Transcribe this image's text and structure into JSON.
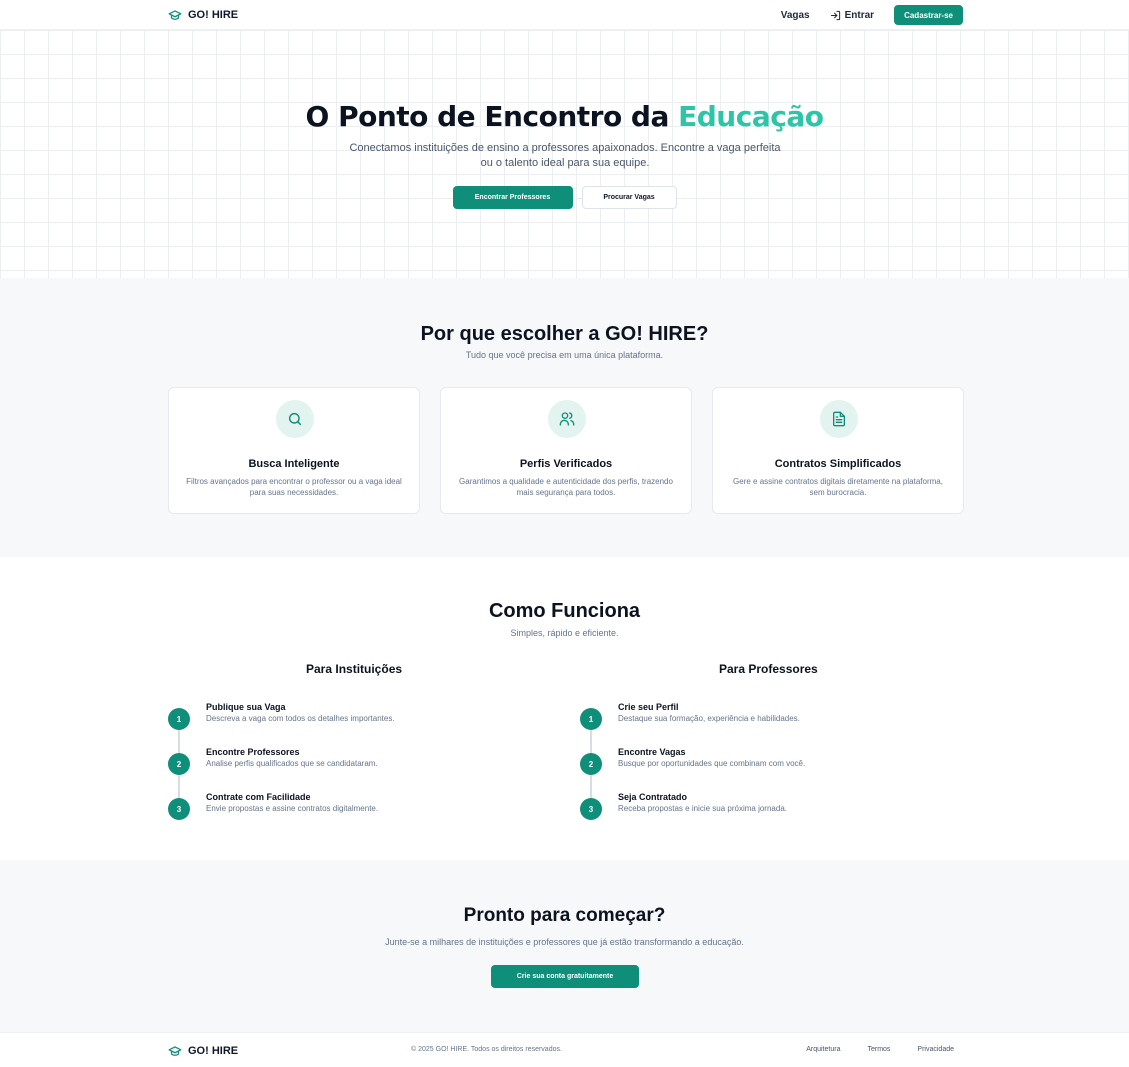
{
  "brand": {
    "name": "GO! HIRE",
    "icon": "graduation-cap-icon",
    "accent_color": "#0f8f7a",
    "highlight_color": "#2ec4a6"
  },
  "header": {
    "nav": {
      "jobs": "Vagas",
      "login": "Entrar",
      "signup": "Cadastrar-se"
    }
  },
  "hero": {
    "title_prefix": "O Ponto de Encontro da ",
    "title_highlight": "Educação",
    "subtitle": "Conectamos instituições de ensino a professores apaixonados. Encontre a vaga perfeita ou o talento ideal para sua equipe.",
    "primary_cta": "Encontrar Professores",
    "secondary_cta": "Procurar Vagas"
  },
  "why": {
    "title": "Por que escolher a GO! HIRE?",
    "subtitle": "Tudo que você precisa em uma única plataforma.",
    "cards": [
      {
        "icon": "search-icon",
        "title": "Busca Inteligente",
        "description": "Filtros avançados para encontrar o professor ou a vaga ideal para suas necessidades."
      },
      {
        "icon": "users-icon",
        "title": "Perfis Verificados",
        "description": "Garantimos a qualidade e autenticidade dos perfis, trazendo mais segurança para todos."
      },
      {
        "icon": "document-icon",
        "title": "Contratos Simplificados",
        "description": "Gere e assine contratos digitais diretamente na plataforma, sem burocracia."
      }
    ]
  },
  "how": {
    "title": "Como Funciona",
    "subtitle": "Simples, rápido e eficiente.",
    "institutions": {
      "title": "Para Instituições",
      "steps": [
        {
          "num": "1",
          "title": "Publique sua Vaga",
          "description": "Descreva a vaga com todos os detalhes importantes."
        },
        {
          "num": "2",
          "title": "Encontre Professores",
          "description": "Analise perfis qualificados que se candidataram."
        },
        {
          "num": "3",
          "title": "Contrate com Facilidade",
          "description": "Envie propostas e assine contratos digitalmente."
        }
      ]
    },
    "teachers": {
      "title": "Para Professores",
      "steps": [
        {
          "num": "1",
          "title": "Crie seu Perfil",
          "description": "Destaque sua formação, experiência e habilidades."
        },
        {
          "num": "2",
          "title": "Encontre Vagas",
          "description": "Busque por oportunidades que combinam com você."
        },
        {
          "num": "3",
          "title": "Seja Contratado",
          "description": "Receba propostas e inicie sua próxima jornada."
        }
      ]
    }
  },
  "ready": {
    "title": "Pronto para começar?",
    "subtitle": "Junte-se a milhares de instituições e professores que já estão transformando a educação.",
    "cta": "Crie sua conta gratuitamente"
  },
  "footer": {
    "copyright": "© 2025 GO! HIRE. Todos os direitos reservados.",
    "links": [
      "Arquitetura",
      "Termos",
      "Privacidade"
    ]
  }
}
